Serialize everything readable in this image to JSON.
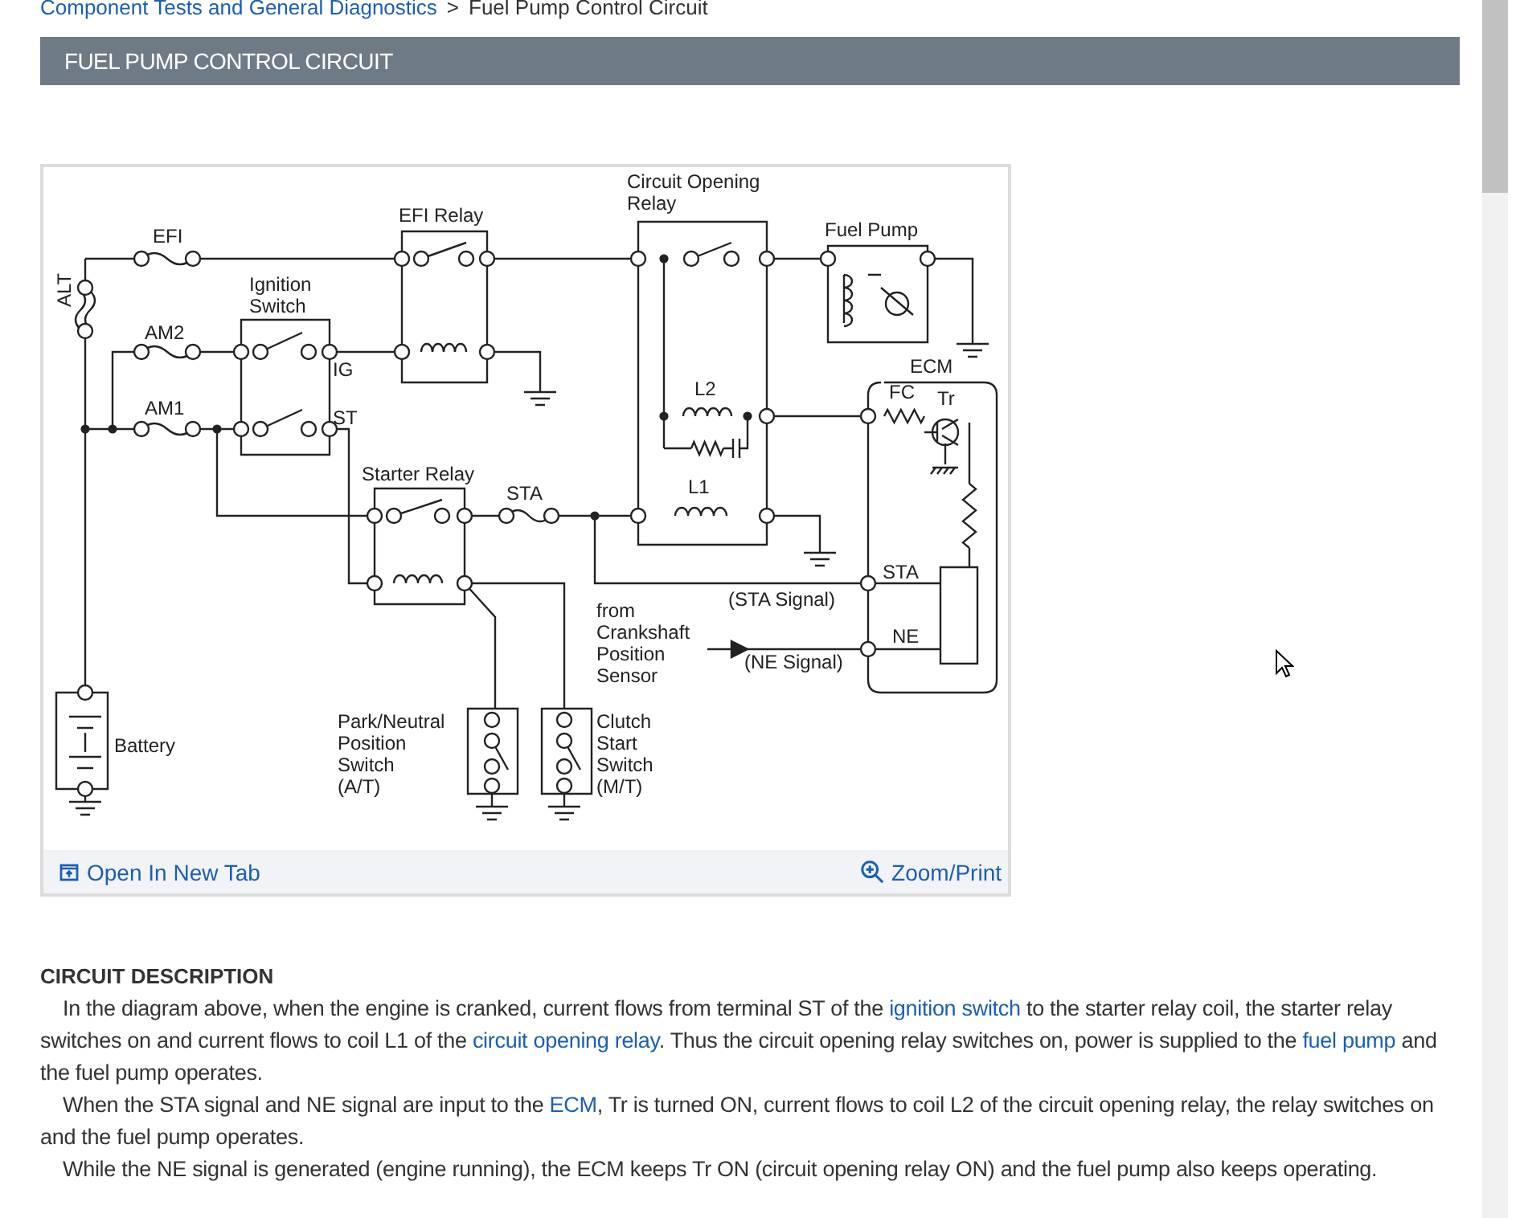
{
  "breadcrumb": {
    "link": "Component Tests and General Diagnostics",
    "separator": ">",
    "current": "Fuel Pump Control Circuit"
  },
  "heading": "FUEL PUMP CONTROL CIRCUIT",
  "diagram": {
    "labels": [
      {
        "lines": [
          "EFI"
        ]
      },
      {
        "lines": [
          "ALT"
        ]
      },
      {
        "lines": [
          "EFI Relay"
        ]
      },
      {
        "lines": [
          "Ignition",
          "Switch"
        ]
      },
      {
        "lines": [
          "AM2"
        ]
      },
      {
        "lines": [
          "IG"
        ]
      },
      {
        "lines": [
          "AM1"
        ]
      },
      {
        "lines": [
          "ST"
        ]
      },
      {
        "lines": [
          "Circuit Opening",
          "Relay"
        ]
      },
      {
        "lines": [
          "Fuel Pump"
        ]
      },
      {
        "lines": [
          "ECM"
        ]
      },
      {
        "lines": [
          "FC"
        ]
      },
      {
        "lines": [
          "Tr"
        ]
      },
      {
        "lines": [
          "L2"
        ]
      },
      {
        "lines": [
          "Starter Relay"
        ]
      },
      {
        "lines": [
          "STA"
        ]
      },
      {
        "lines": [
          "L1"
        ]
      },
      {
        "lines": [
          "STA"
        ]
      },
      {
        "lines": [
          "(STA Signal)"
        ]
      },
      {
        "lines": [
          "from",
          "Crankshaft",
          "Position",
          "Sensor"
        ]
      },
      {
        "lines": [
          "NE"
        ]
      },
      {
        "lines": [
          "(NE Signal)"
        ]
      },
      {
        "lines": [
          "Battery"
        ]
      },
      {
        "lines": [
          "Park/Neutral",
          "Position",
          "Switch",
          "(A/T)"
        ]
      },
      {
        "lines": [
          "Clutch",
          "Start",
          "Switch",
          "(M/T)"
        ]
      }
    ],
    "open_link": "Open In New Tab",
    "zoom_link": "Zoom/Print"
  },
  "section_title": "CIRCUIT DESCRIPTION",
  "paragraphs": [
    [
      {
        "kind": "text",
        "text": "In the diagram above, when the engine is cranked, current flows from terminal ST of the "
      },
      {
        "kind": "link",
        "text": "ignition switch"
      },
      {
        "kind": "text",
        "text": " to the starter relay coil, the starter relay switches on and current flows to coil L1 of the "
      },
      {
        "kind": "link",
        "text": "circuit opening relay"
      },
      {
        "kind": "text",
        "text": ". Thus the circuit opening relay switches on, power is supplied to the "
      },
      {
        "kind": "link",
        "text": "fuel pump"
      },
      {
        "kind": "text",
        "text": " and the fuel pump operates."
      }
    ],
    [
      {
        "kind": "text",
        "text": "When the STA signal and NE signal are input to the "
      },
      {
        "kind": "link",
        "text": "ECM"
      },
      {
        "kind": "text",
        "text": ", Tr is turned ON, current flows to coil L2 of the circuit opening relay, the relay switches on and the fuel pump operates."
      }
    ],
    [
      {
        "kind": "text",
        "text": "While the NE signal is generated (engine running), the ECM keeps Tr ON (circuit opening relay ON) and the fuel pump also keeps operating."
      }
    ]
  ]
}
